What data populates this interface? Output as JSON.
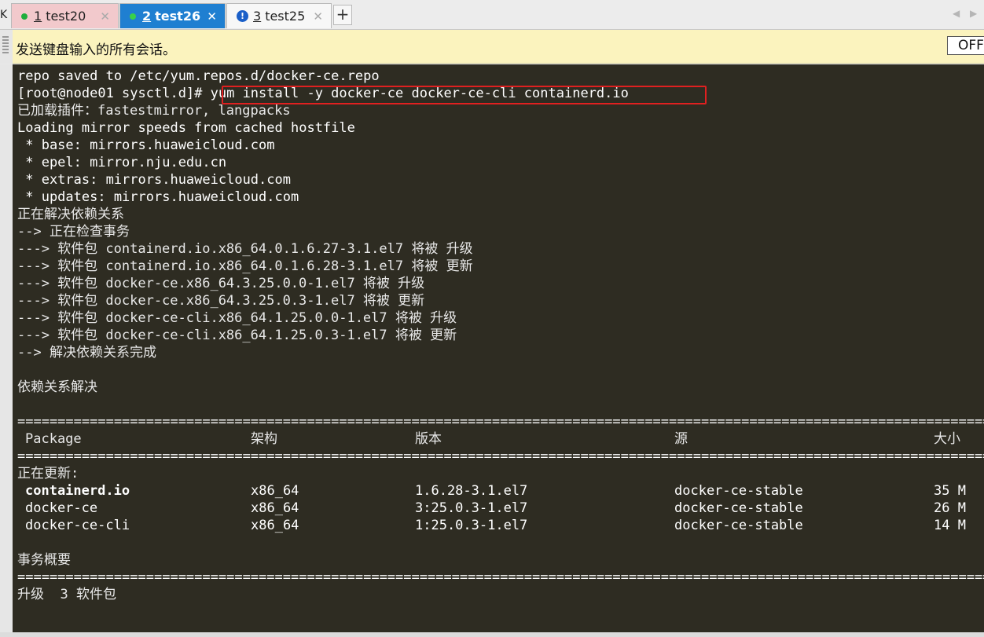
{
  "tabs": [
    {
      "number": "1",
      "title": "test20",
      "status_color": "#1fae3c",
      "close": "✕"
    },
    {
      "number": "2",
      "title": "test26",
      "status_color": "#39d04a",
      "close": "✕"
    },
    {
      "number": "3",
      "title": "test25",
      "status_icon": "warning-icon",
      "close": "✕"
    }
  ],
  "tabbar": {
    "left_glyph": "K",
    "add": "+",
    "prev": "◀",
    "next": "▶"
  },
  "notice": {
    "text": "发送键盘输入的所有会话。",
    "off_label": "OFF"
  },
  "colors": {
    "terminal_bg": "#2e2c22",
    "active_tab": "#1f7fd1",
    "inactive_tab": "#f2c9cc",
    "notice_bg": "#fbf3be",
    "highlight_box": "#e02020"
  },
  "terminal": {
    "lines": [
      "repo saved to /etc/yum.repos.d/docker-ce.repo",
      "[root@node01 sysctl.d]# yum install -y docker-ce docker-ce-cli containerd.io",
      "已加载插件：fastestmirror, langpacks",
      "Loading mirror speeds from cached hostfile",
      " * base: mirrors.huaweicloud.com",
      " * epel: mirror.nju.edu.cn",
      " * extras: mirrors.huaweicloud.com",
      " * updates: mirrors.huaweicloud.com",
      "正在解决依赖关系",
      "--> 正在检查事务",
      "---> 软件包 containerd.io.x86_64.0.1.6.27-3.1.el7 将被 升级",
      "---> 软件包 containerd.io.x86_64.0.1.6.28-3.1.el7 将被 更新",
      "---> 软件包 docker-ce.x86_64.3.25.0.0-1.el7 将被 升级",
      "---> 软件包 docker-ce.x86_64.3.25.0.3-1.el7 将被 更新",
      "---> 软件包 docker-ce-cli.x86_64.1.25.0.0-1.el7 将被 升级",
      "---> 软件包 docker-ce-cli.x86_64.1.25.0.3-1.el7 将被 更新",
      "--> 解决依赖关系完成",
      "依赖关系解决",
      "正在更新:",
      "事务概要",
      "升级  3 软件包"
    ],
    "separator": "=============================================================================================================================",
    "table_headers": {
      "package": "Package",
      "arch": "架构",
      "version": "版本",
      "repo": "源",
      "size": "大小"
    },
    "packages": [
      {
        "name": "containerd.io",
        "arch": "x86_64",
        "version": "1.6.28-3.1.el7",
        "repo": "docker-ce-stable",
        "size": "35 M"
      },
      {
        "name": "docker-ce",
        "arch": "x86_64",
        "version": "3:25.0.3-1.el7",
        "repo": "docker-ce-stable",
        "size": "26 M"
      },
      {
        "name": "docker-ce-cli",
        "arch": "x86_64",
        "version": "1:25.0.3-1.el7",
        "repo": "docker-ce-stable",
        "size": "14 M"
      }
    ]
  }
}
